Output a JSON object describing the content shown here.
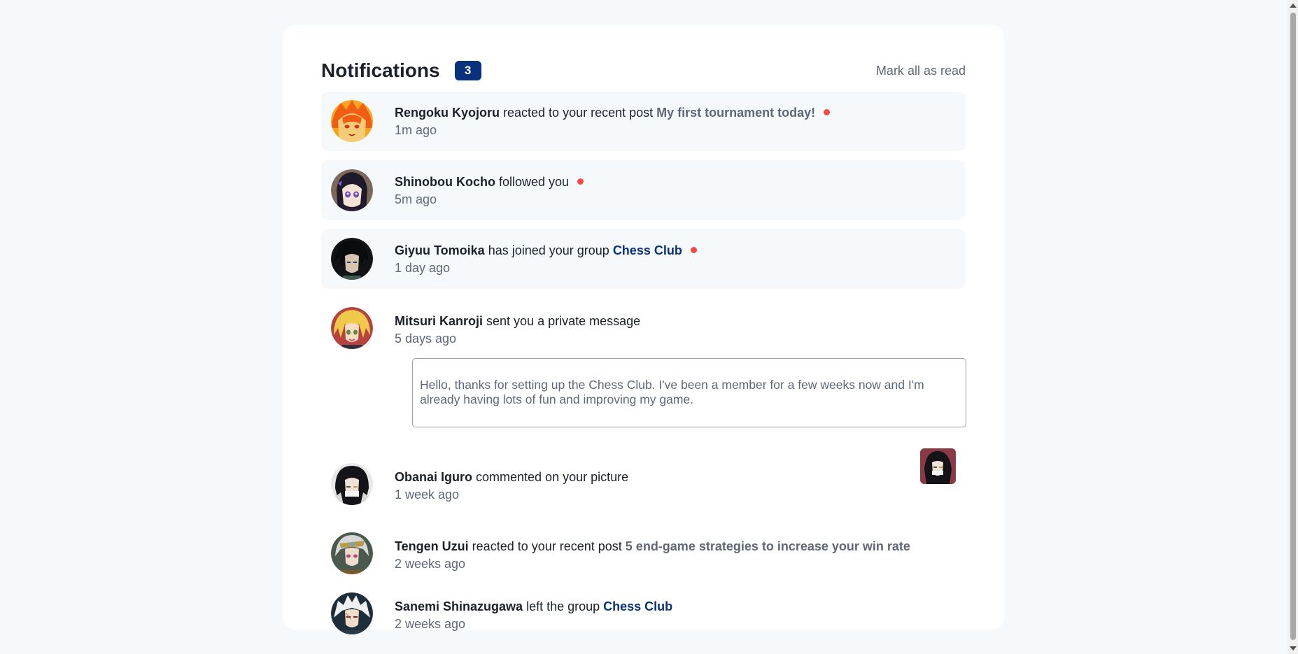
{
  "header": {
    "title": "Notifications",
    "unread_count": "3",
    "mark_all_label": "Mark all as read"
  },
  "notifications": [
    {
      "name": "Rengoku Kyojoru",
      "action": " reacted to your recent post ",
      "target": "My first tournament today!",
      "target_type": "post",
      "time": "1m ago",
      "unread": true
    },
    {
      "name": "Shinobou Kocho",
      "action": " followed you",
      "target": "",
      "time": "5m ago",
      "unread": true
    },
    {
      "name": "Giyuu Tomoika",
      "action": " has joined your group ",
      "target": "Chess Club",
      "target_type": "group",
      "time": "1 day ago",
      "unread": true
    },
    {
      "name": "Mitsuri Kanroji",
      "action": " sent you a private message",
      "target": "",
      "time": "5 days ago",
      "unread": false,
      "message": "Hello, thanks for setting up the Chess Club. I've been a member for a few weeks now and I'm already having lots of fun and improving my game."
    },
    {
      "name": "Obanai Iguro",
      "action": " commented on your picture",
      "target": "",
      "time": "1 week ago",
      "unread": false
    },
    {
      "name": "Tengen Uzui",
      "action": " reacted to your recent post ",
      "target": "5 end-game strategies to increase your win rate",
      "target_type": "post",
      "time": "2 weeks ago",
      "unread": false
    },
    {
      "name": "Sanemi Shinazugawa",
      "action": " left the group ",
      "target": "Chess Club",
      "target_type": "group",
      "time": "2 weeks ago",
      "unread": false
    }
  ],
  "colors": {
    "accent": "#0a317b",
    "unread_dot": "#f44a4a",
    "unread_bg": "#f6f9fc",
    "muted_text": "#5e6778"
  }
}
